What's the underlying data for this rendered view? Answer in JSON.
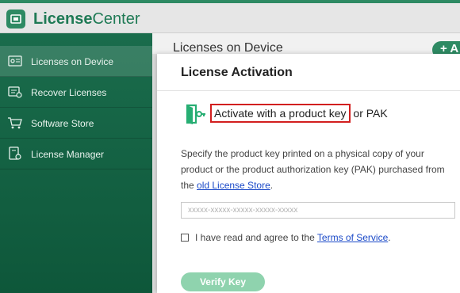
{
  "app": {
    "title_bold": "License",
    "title_rest": "Center"
  },
  "sidebar": {
    "items": [
      {
        "label": "Licenses on Device",
        "icon": "license-card-icon",
        "active": true
      },
      {
        "label": "Recover Licenses",
        "icon": "recover-licenses-icon",
        "active": false
      },
      {
        "label": "Software Store",
        "icon": "shopping-cart-icon",
        "active": false
      },
      {
        "label": "License Manager",
        "icon": "license-manager-icon",
        "active": false
      }
    ]
  },
  "main": {
    "title": "Licenses on Device",
    "add_label": "+ A"
  },
  "dialog": {
    "title": "License Activation",
    "activate_highlighted": "Activate with a product key",
    "activate_rest": " or PAK",
    "description_text": "Specify the product key printed on a physical copy of your product or the product authorization key (PAK) purchased from the ",
    "description_link": "old License Store",
    "description_end": ".",
    "key_placeholder": "xxxxx-xxxxx-xxxxx-xxxxx-xxxxx",
    "key_value": "",
    "agree_text": "I have read and agree to the ",
    "agree_link": "Terms of Service",
    "agree_end": ".",
    "verify_label": "Verify Key"
  },
  "colors": {
    "brand_green": "#2e8a63",
    "highlight_red": "#d21f1f",
    "link_blue": "#1a49c8"
  }
}
